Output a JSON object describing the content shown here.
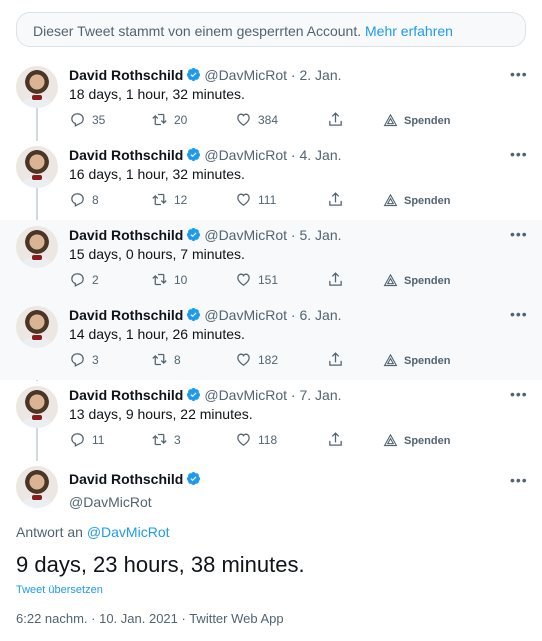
{
  "notice": {
    "text": "Dieser Tweet stammt von einem gesperrten Account.",
    "link": "Mehr erfahren"
  },
  "tweets": [
    {
      "name": "David Rothschild",
      "handle": "@DavMicRot",
      "date": "· 2. Jan.",
      "text": "18 days, 1 hour, 32 minutes.",
      "replies": "35",
      "retweets": "20",
      "likes": "384",
      "donate": "Spenden"
    },
    {
      "name": "David Rothschild",
      "handle": "@DavMicRot",
      "date": "· 4. Jan.",
      "text": "16 days, 1 hour, 32 minutes.",
      "replies": "8",
      "retweets": "12",
      "likes": "111",
      "donate": "Spenden"
    },
    {
      "name": "David Rothschild",
      "handle": "@DavMicRot",
      "date": "· 5. Jan.",
      "text": "15 days, 0 hours, 7 minutes.",
      "replies": "2",
      "retweets": "10",
      "likes": "151",
      "donate": "Spenden"
    },
    {
      "name": "David Rothschild",
      "handle": "@DavMicRot",
      "date": "· 6. Jan.",
      "text": "14 days, 1 hour, 26 minutes.",
      "replies": "3",
      "retweets": "8",
      "likes": "182",
      "donate": "Spenden"
    },
    {
      "name": "David Rothschild",
      "handle": "@DavMicRot",
      "date": "· 7. Jan.",
      "text": "13 days, 9 hours, 22 minutes.",
      "replies": "11",
      "retweets": "3",
      "likes": "118",
      "donate": "Spenden"
    }
  ],
  "focus": {
    "name": "David Rothschild",
    "handle": "@DavMicRot",
    "reply_label": "Antwort an",
    "reply_handle": "@DavMicRot",
    "text": "9 days, 23 hours, 38 minutes.",
    "translate": "Tweet übersetzen",
    "meta": "6:22 nachm. · 10. Jan. 2021 · Twitter Web App"
  },
  "colors": {
    "accent": "#1d9bf0",
    "muted": "#536471",
    "highlight_bg": "#f7f9fa"
  },
  "icons": [
    "verified-badge-icon",
    "reply-icon",
    "retweet-icon",
    "like-icon",
    "share-icon",
    "donate-icon",
    "more-icon"
  ]
}
